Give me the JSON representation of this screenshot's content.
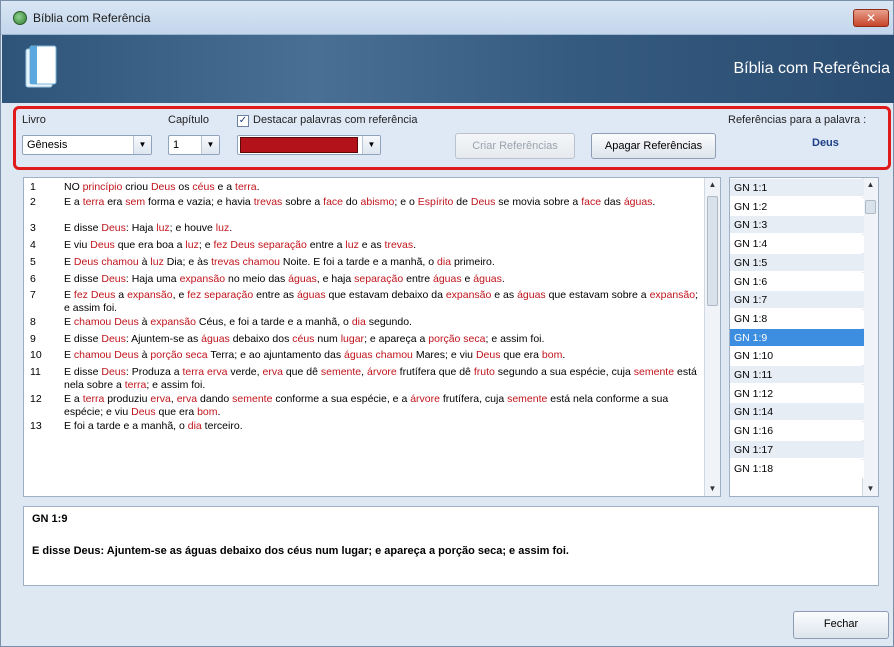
{
  "window": {
    "title": "Bíblia com Referência",
    "banner_title": "Bíblia com Referência",
    "close_glyph": "✕"
  },
  "toolbar": {
    "livro_label": "Livro",
    "livro_value": "Gênesis",
    "capitulo_label": "Capítulo",
    "capitulo_value": "1",
    "highlight_checked": true,
    "highlight_label": "Destacar palavras com referência",
    "highlight_color": "#b3121a",
    "criar_label": "Criar Referências",
    "apagar_label": "Apagar Referências",
    "referencias_label": "Referências para a palavra :",
    "word_value": "Deus"
  },
  "verses": [
    {
      "num": "1",
      "segments": [
        [
          "NO ",
          0
        ],
        [
          "princípio",
          1
        ],
        [
          " criou ",
          0
        ],
        [
          "Deus",
          1
        ],
        [
          " os ",
          0
        ],
        [
          "céus",
          1
        ],
        [
          " e a ",
          0
        ],
        [
          "terra",
          1
        ],
        [
          ".",
          0
        ]
      ]
    },
    {
      "num": "2",
      "segments": [
        [
          "E a ",
          0
        ],
        [
          "terra",
          1
        ],
        [
          " era ",
          0
        ],
        [
          "sem",
          1
        ],
        [
          " forma e vazia; e havia ",
          0
        ],
        [
          "trevas",
          1
        ],
        [
          " sobre a ",
          0
        ],
        [
          "face",
          1
        ],
        [
          " do ",
          0
        ],
        [
          "abismo",
          1
        ],
        [
          "; e o ",
          0
        ],
        [
          "Espírito",
          1
        ],
        [
          " de ",
          0
        ],
        [
          "Deus",
          1
        ],
        [
          " se movia sobre a ",
          0
        ],
        [
          "face",
          1
        ],
        [
          " das ",
          0
        ],
        [
          "águas",
          1
        ],
        [
          ".",
          0
        ]
      ]
    },
    {
      "num": "3",
      "segments": [
        [
          "E disse ",
          0
        ],
        [
          "Deus",
          1
        ],
        [
          ": Haja ",
          0
        ],
        [
          "luz",
          1
        ],
        [
          "; e houve ",
          0
        ],
        [
          "luz",
          1
        ],
        [
          ".",
          0
        ]
      ]
    },
    {
      "num": "4",
      "segments": [
        [
          "E viu ",
          0
        ],
        [
          "Deus",
          1
        ],
        [
          " que era boa a ",
          0
        ],
        [
          "luz",
          1
        ],
        [
          "; e ",
          0
        ],
        [
          "fez",
          1
        ],
        [
          " ",
          0
        ],
        [
          "Deus",
          1
        ],
        [
          " ",
          0
        ],
        [
          "separação",
          1
        ],
        [
          " entre a ",
          0
        ],
        [
          "luz",
          1
        ],
        [
          " e as ",
          0
        ],
        [
          "trevas",
          1
        ],
        [
          ".",
          0
        ]
      ]
    },
    {
      "num": "5",
      "segments": [
        [
          "E ",
          0
        ],
        [
          "Deus",
          1
        ],
        [
          " ",
          0
        ],
        [
          "chamou",
          1
        ],
        [
          " à ",
          0
        ],
        [
          "luz",
          1
        ],
        [
          " Dia; e às ",
          0
        ],
        [
          "trevas",
          1
        ],
        [
          " ",
          0
        ],
        [
          "chamou",
          1
        ],
        [
          " Noite. E foi a tarde e a manhã, o ",
          0
        ],
        [
          "dia",
          1
        ],
        [
          " primeiro.",
          0
        ]
      ]
    },
    {
      "num": "6",
      "segments": [
        [
          "E disse ",
          0
        ],
        [
          "Deus",
          1
        ],
        [
          ": Haja uma ",
          0
        ],
        [
          "expansão",
          1
        ],
        [
          " no meio das ",
          0
        ],
        [
          "águas",
          1
        ],
        [
          ", e haja ",
          0
        ],
        [
          "separação",
          1
        ],
        [
          " entre ",
          0
        ],
        [
          "águas",
          1
        ],
        [
          " e ",
          0
        ],
        [
          "águas",
          1
        ],
        [
          ".",
          0
        ]
      ]
    },
    {
      "num": "7",
      "segments": [
        [
          "E ",
          0
        ],
        [
          "fez",
          1
        ],
        [
          " ",
          0
        ],
        [
          "Deus",
          1
        ],
        [
          " a ",
          0
        ],
        [
          "expansão",
          1
        ],
        [
          ", e ",
          0
        ],
        [
          "fez",
          1
        ],
        [
          " ",
          0
        ],
        [
          "separação",
          1
        ],
        [
          " entre as ",
          0
        ],
        [
          "águas",
          1
        ],
        [
          " que estavam debaixo da ",
          0
        ],
        [
          "expansão",
          1
        ],
        [
          " e as ",
          0
        ],
        [
          "águas",
          1
        ],
        [
          " que estavam sobre a ",
          0
        ],
        [
          "expansão",
          1
        ],
        [
          "; e assim foi.",
          0
        ]
      ]
    },
    {
      "num": "8",
      "segments": [
        [
          "E ",
          0
        ],
        [
          "chamou",
          1
        ],
        [
          " ",
          0
        ],
        [
          "Deus",
          1
        ],
        [
          " à ",
          0
        ],
        [
          "expansão",
          1
        ],
        [
          " Céus, e foi a tarde e a manhã, o ",
          0
        ],
        [
          "dia",
          1
        ],
        [
          " segundo.",
          0
        ]
      ]
    },
    {
      "num": "9",
      "segments": [
        [
          "E disse ",
          0
        ],
        [
          "Deus",
          1
        ],
        [
          ": Ajuntem-se as ",
          0
        ],
        [
          "águas",
          1
        ],
        [
          " debaixo dos ",
          0
        ],
        [
          "céus",
          1
        ],
        [
          " num ",
          0
        ],
        [
          "lugar",
          1
        ],
        [
          "; e apareça a ",
          0
        ],
        [
          "porção seca",
          1
        ],
        [
          "; e assim foi.",
          0
        ]
      ]
    },
    {
      "num": "10",
      "segments": [
        [
          "E ",
          0
        ],
        [
          "chamou",
          1
        ],
        [
          " ",
          0
        ],
        [
          "Deus",
          1
        ],
        [
          " à ",
          0
        ],
        [
          "porção seca",
          1
        ],
        [
          " Terra; e ao ajuntamento das ",
          0
        ],
        [
          "águas",
          1
        ],
        [
          " ",
          0
        ],
        [
          "chamou",
          1
        ],
        [
          " Mares; e viu ",
          0
        ],
        [
          "Deus",
          1
        ],
        [
          " que era ",
          0
        ],
        [
          "bom",
          1
        ],
        [
          ".",
          0
        ]
      ]
    },
    {
      "num": "11",
      "segments": [
        [
          "E disse ",
          0
        ],
        [
          "Deus",
          1
        ],
        [
          ": Produza a ",
          0
        ],
        [
          "terra",
          1
        ],
        [
          " ",
          0
        ],
        [
          "erva",
          1
        ],
        [
          " verde, ",
          0
        ],
        [
          "erva",
          1
        ],
        [
          " que dê ",
          0
        ],
        [
          "semente",
          1
        ],
        [
          ", ",
          0
        ],
        [
          "árvore",
          1
        ],
        [
          " frutífera que dê ",
          0
        ],
        [
          "fruto",
          1
        ],
        [
          " segundo a sua espécie, cuja ",
          0
        ],
        [
          "semente",
          1
        ],
        [
          " está nela sobre a ",
          0
        ],
        [
          "terra",
          1
        ],
        [
          "; e assim foi.",
          0
        ]
      ]
    },
    {
      "num": "12",
      "segments": [
        [
          "E a ",
          0
        ],
        [
          "terra",
          1
        ],
        [
          " produziu ",
          0
        ],
        [
          "erva",
          1
        ],
        [
          ", ",
          0
        ],
        [
          "erva",
          1
        ],
        [
          " dando ",
          0
        ],
        [
          "semente",
          1
        ],
        [
          " conforme a sua espécie, e a ",
          0
        ],
        [
          "árvore",
          1
        ],
        [
          " frutífera, cuja ",
          0
        ],
        [
          "semente",
          1
        ],
        [
          " está nela conforme a sua espécie; e viu ",
          0
        ],
        [
          "Deus",
          1
        ],
        [
          " que era ",
          0
        ],
        [
          "bom",
          1
        ],
        [
          ".",
          0
        ]
      ]
    },
    {
      "num": "13",
      "segments": [
        [
          "E foi a tarde e a manhã, o ",
          0
        ],
        [
          "dia",
          1
        ],
        [
          " terceiro.",
          0
        ]
      ]
    }
  ],
  "references": [
    "GN 1:1",
    "GN 1:2",
    "GN 1:3",
    "GN 1:4",
    "GN 1:5",
    "GN 1:6",
    "GN 1:7",
    "GN 1:8",
    "GN 1:9",
    "GN 1:10",
    "GN 1:11",
    "GN 1:12",
    "GN 1:14",
    "GN 1:16",
    "GN 1:17",
    "GN 1:18"
  ],
  "selected_reference": "GN 1:9",
  "detail": {
    "reference": "GN 1:9",
    "text": "E disse Deus: Ajuntem-se as águas debaixo dos céus num lugar; e apareça a porção seca; e assim foi."
  },
  "footer": {
    "fechar_label": "Fechar"
  },
  "colors": {
    "reference_word": "#c0141c",
    "selection": "#3d8ee0",
    "highlight_frame": "#e01b1b"
  }
}
